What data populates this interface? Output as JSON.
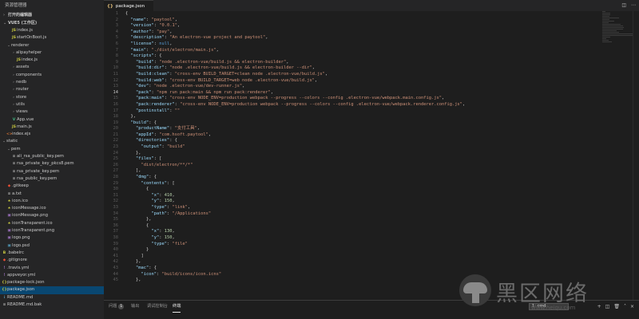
{
  "sidebar": {
    "title": "资源管理器",
    "open_editors": "打开的编辑器",
    "workspace": "VUE5 (工作区)",
    "items": [
      {
        "label": "index.js",
        "indent": 14,
        "icon": "JS",
        "color": "#cbcb41"
      },
      {
        "label": "startOnBoot.js",
        "indent": 14,
        "icon": "JS",
        "color": "#cbcb41"
      },
      {
        "label": "renderer",
        "indent": 8,
        "arrow": "⌄"
      },
      {
        "label": "alipayhelper",
        "indent": 14,
        "arrow": "›"
      },
      {
        "label": "index.js",
        "indent": 20,
        "icon": "JS",
        "color": "#cbcb41"
      },
      {
        "label": "assets",
        "indent": 14,
        "arrow": "›"
      },
      {
        "label": "components",
        "indent": 14,
        "arrow": "›"
      },
      {
        "label": "nedb",
        "indent": 14,
        "arrow": "›"
      },
      {
        "label": "router",
        "indent": 14,
        "arrow": "›"
      },
      {
        "label": "store",
        "indent": 14,
        "arrow": "›"
      },
      {
        "label": "utils",
        "indent": 14,
        "arrow": "›"
      },
      {
        "label": "views",
        "indent": 14,
        "arrow": "›"
      },
      {
        "label": "App.vue",
        "indent": 14,
        "icon": "V",
        "color": "#41b883"
      },
      {
        "label": "main.js",
        "indent": 14,
        "icon": "JS",
        "color": "#cbcb41"
      },
      {
        "label": "index.ejs",
        "indent": 8,
        "icon": "<>",
        "color": "#e37933"
      },
      {
        "label": "static",
        "indent": 2,
        "arrow": "⌄"
      },
      {
        "label": "pem",
        "indent": 8,
        "arrow": "⌄"
      },
      {
        "label": "ali_rsa_public_key.pem",
        "indent": 14,
        "icon": "≡",
        "color": "#aaaaaa"
      },
      {
        "label": "rsa_private_key_pkcs8.pem",
        "indent": 14,
        "icon": "≡",
        "color": "#aaaaaa"
      },
      {
        "label": "rsa_private_key.pem",
        "indent": 14,
        "icon": "≡",
        "color": "#aaaaaa"
      },
      {
        "label": "rsa_public_key.pem",
        "indent": 14,
        "icon": "≡",
        "color": "#aaaaaa"
      },
      {
        "label": ".gitkeep",
        "indent": 8,
        "icon": "◆",
        "color": "#f05033"
      },
      {
        "label": "a.txt",
        "indent": 8,
        "icon": "≡",
        "color": "#aaaaaa"
      },
      {
        "label": "icon.ico",
        "indent": 8,
        "icon": "★",
        "color": "#cbcb41"
      },
      {
        "label": "iconMessage.ico",
        "indent": 8,
        "icon": "★",
        "color": "#cbcb41"
      },
      {
        "label": "iconMessage.png",
        "indent": 8,
        "icon": "▣",
        "color": "#a074c4"
      },
      {
        "label": "iconTransparent.ico",
        "indent": 8,
        "icon": "★",
        "color": "#cbcb41"
      },
      {
        "label": "iconTransparent.png",
        "indent": 8,
        "icon": "▣",
        "color": "#a074c4"
      },
      {
        "label": "logo.png",
        "indent": 8,
        "icon": "▣",
        "color": "#a074c4"
      },
      {
        "label": "logo.psd",
        "indent": 8,
        "icon": "▣",
        "color": "#519aba"
      },
      {
        "label": ".babelrc",
        "indent": 2,
        "icon": "B",
        "color": "#cbcb41"
      },
      {
        "label": ".gitignore",
        "indent": 2,
        "icon": "◆",
        "color": "#f05033"
      },
      {
        "label": ".travis.yml",
        "indent": 2,
        "icon": "!",
        "color": "#a074c4"
      },
      {
        "label": "appveyor.yml",
        "indent": 2,
        "icon": "!",
        "color": "#a074c4"
      },
      {
        "label": "package-lock.json",
        "indent": 2,
        "icon": "{}",
        "color": "#cbcb41"
      },
      {
        "label": "package.json",
        "indent": 2,
        "icon": "{}",
        "color": "#cbcb41",
        "state": "active"
      },
      {
        "label": "README.md",
        "indent": 2,
        "icon": "i",
        "color": "#519aba"
      },
      {
        "label": "README.md.bak",
        "indent": 2,
        "icon": "≡",
        "color": "#aaaaaa"
      }
    ]
  },
  "tab": {
    "icon": "{}",
    "label": "package.json"
  },
  "editor": {
    "current_line": 14,
    "lines": [
      [
        [
          "p",
          "{"
        ]
      ],
      [
        [
          "p",
          "  "
        ],
        [
          "k",
          "\"name\""
        ],
        [
          "p",
          ": "
        ],
        [
          "s",
          "\"paytool\""
        ],
        [
          "p",
          ","
        ]
      ],
      [
        [
          "p",
          "  "
        ],
        [
          "k",
          "\"version\""
        ],
        [
          "p",
          ": "
        ],
        [
          "s",
          "\"0.0.1\""
        ],
        [
          "p",
          ","
        ]
      ],
      [
        [
          "p",
          "  "
        ],
        [
          "k",
          "\"author\""
        ],
        [
          "p",
          ": "
        ],
        [
          "s",
          "\"pay\""
        ],
        [
          "p",
          ","
        ]
      ],
      [
        [
          "p",
          "  "
        ],
        [
          "k",
          "\"description\""
        ],
        [
          "p",
          ": "
        ],
        [
          "s",
          "\"An electron-vue project and paytool\""
        ],
        [
          "p",
          ","
        ]
      ],
      [
        [
          "p",
          "  "
        ],
        [
          "k",
          "\"license\""
        ],
        [
          "p",
          ": "
        ],
        [
          "c",
          "null"
        ],
        [
          "p",
          ","
        ]
      ],
      [
        [
          "p",
          "  "
        ],
        [
          "k",
          "\"main\""
        ],
        [
          "p",
          ": "
        ],
        [
          "s",
          "\"./dist/electron/main.js\""
        ],
        [
          "p",
          ","
        ]
      ],
      [
        [
          "p",
          "  "
        ],
        [
          "k",
          "\"scripts\""
        ],
        [
          "p",
          ": {"
        ]
      ],
      [
        [
          "p",
          "    "
        ],
        [
          "k",
          "\"build\""
        ],
        [
          "p",
          ": "
        ],
        [
          "s",
          "\"node .electron-vue/build.js && electron-builder\""
        ],
        [
          "p",
          ","
        ]
      ],
      [
        [
          "p",
          "    "
        ],
        [
          "k",
          "\"build:dir\""
        ],
        [
          "p",
          ": "
        ],
        [
          "s",
          "\"node .electron-vue/build.js && electron-builder --dir\""
        ],
        [
          "p",
          ","
        ]
      ],
      [
        [
          "p",
          "    "
        ],
        [
          "k",
          "\"build:clean\""
        ],
        [
          "p",
          ": "
        ],
        [
          "s",
          "\"cross-env BUILD_TARGET=clean node .electron-vue/build.js\""
        ],
        [
          "p",
          ","
        ]
      ],
      [
        [
          "p",
          "    "
        ],
        [
          "k",
          "\"build:web\""
        ],
        [
          "p",
          ": "
        ],
        [
          "s",
          "\"cross-env BUILD_TARGET=web node .electron-vue/build.js\""
        ],
        [
          "p",
          ","
        ]
      ],
      [
        [
          "p",
          "    "
        ],
        [
          "k",
          "\"dev\""
        ],
        [
          "p",
          ": "
        ],
        [
          "s",
          "\"node .electron-vue/dev-runner.js\""
        ],
        [
          "p",
          ","
        ]
      ],
      [
        [
          "p",
          "    "
        ],
        [
          "k",
          "\"pack\""
        ],
        [
          "p",
          ": "
        ],
        [
          "s",
          "\"npm run pack:main && npm run pack:renderer\""
        ],
        [
          "p",
          ","
        ]
      ],
      [
        [
          "p",
          "    "
        ],
        [
          "k",
          "\"pack:main\""
        ],
        [
          "p",
          ": "
        ],
        [
          "s",
          "\"cross-env NODE_ENV=production webpack --progress --colors --config .electron-vue/webpack.main.config.js\""
        ],
        [
          "p",
          ","
        ]
      ],
      [
        [
          "p",
          "    "
        ],
        [
          "k",
          "\"pack:renderer\""
        ],
        [
          "p",
          ": "
        ],
        [
          "s",
          "\"cross-env NODE_ENV=production webpack --progress --colors --config .electron-vue/webpack.renderer.config.js\""
        ],
        [
          "p",
          ","
        ]
      ],
      [
        [
          "p",
          "    "
        ],
        [
          "k",
          "\"postinstall\""
        ],
        [
          "p",
          ": "
        ],
        [
          "s",
          "\"\""
        ]
      ],
      [
        [
          "p",
          "  },"
        ]
      ],
      [
        [
          "p",
          "  "
        ],
        [
          "k",
          "\"build\""
        ],
        [
          "p",
          ": {"
        ]
      ],
      [
        [
          "p",
          "    "
        ],
        [
          "k",
          "\"productName\""
        ],
        [
          "p",
          ": "
        ],
        [
          "s",
          "\"支付工具\""
        ],
        [
          "p",
          ","
        ]
      ],
      [
        [
          "p",
          "    "
        ],
        [
          "k",
          "\"appId\""
        ],
        [
          "p",
          ": "
        ],
        [
          "s",
          "\"com.hsoft.paytool\""
        ],
        [
          "p",
          ","
        ]
      ],
      [
        [
          "p",
          "    "
        ],
        [
          "k",
          "\"directories\""
        ],
        [
          "p",
          ": {"
        ]
      ],
      [
        [
          "p",
          "      "
        ],
        [
          "k",
          "\"output\""
        ],
        [
          "p",
          ": "
        ],
        [
          "s",
          "\"build\""
        ]
      ],
      [
        [
          "p",
          "    },"
        ]
      ],
      [
        [
          "p",
          "    "
        ],
        [
          "k",
          "\"files\""
        ],
        [
          "p",
          ": ["
        ]
      ],
      [
        [
          "p",
          "      "
        ],
        [
          "s",
          "\"dist/electron/**/*\""
        ]
      ],
      [
        [
          "p",
          "    ],"
        ]
      ],
      [
        [
          "p",
          "    "
        ],
        [
          "k",
          "\"dmg\""
        ],
        [
          "p",
          ": {"
        ]
      ],
      [
        [
          "p",
          "      "
        ],
        [
          "k",
          "\"contents\""
        ],
        [
          "p",
          ": ["
        ]
      ],
      [
        [
          "p",
          "        {"
        ]
      ],
      [
        [
          "p",
          "          "
        ],
        [
          "k",
          "\"x\""
        ],
        [
          "p",
          ": "
        ],
        [
          "n",
          "410"
        ],
        [
          "p",
          ","
        ]
      ],
      [
        [
          "p",
          "          "
        ],
        [
          "k",
          "\"y\""
        ],
        [
          "p",
          ": "
        ],
        [
          "n",
          "150"
        ],
        [
          "p",
          ","
        ]
      ],
      [
        [
          "p",
          "          "
        ],
        [
          "k",
          "\"type\""
        ],
        [
          "p",
          ": "
        ],
        [
          "s",
          "\"link\""
        ],
        [
          "p",
          ","
        ]
      ],
      [
        [
          "p",
          "          "
        ],
        [
          "k",
          "\"path\""
        ],
        [
          "p",
          ": "
        ],
        [
          "s",
          "\"/Applications\""
        ]
      ],
      [
        [
          "p",
          "        },"
        ]
      ],
      [
        [
          "p",
          "        {"
        ]
      ],
      [
        [
          "p",
          "          "
        ],
        [
          "k",
          "\"x\""
        ],
        [
          "p",
          ": "
        ],
        [
          "n",
          "130"
        ],
        [
          "p",
          ","
        ]
      ],
      [
        [
          "p",
          "          "
        ],
        [
          "k",
          "\"y\""
        ],
        [
          "p",
          ": "
        ],
        [
          "n",
          "150"
        ],
        [
          "p",
          ","
        ]
      ],
      [
        [
          "p",
          "          "
        ],
        [
          "k",
          "\"type\""
        ],
        [
          "p",
          ": "
        ],
        [
          "s",
          "\"file\""
        ]
      ],
      [
        [
          "p",
          "        }"
        ]
      ],
      [
        [
          "p",
          "      ]"
        ]
      ],
      [
        [
          "p",
          "    },"
        ]
      ],
      [
        [
          "p",
          "    "
        ],
        [
          "k",
          "\"mac\""
        ],
        [
          "p",
          ": {"
        ]
      ],
      [
        [
          "p",
          "      "
        ],
        [
          "k",
          "\"icon\""
        ],
        [
          "p",
          ": "
        ],
        [
          "s",
          "\"build/icons/icon.icns\""
        ]
      ],
      [
        [
          "p",
          "    },"
        ]
      ]
    ]
  },
  "panel": {
    "tabs": [
      {
        "label": "问题",
        "badge": "1"
      },
      {
        "label": "输出"
      },
      {
        "label": "调试控制台"
      },
      {
        "label": "终端",
        "active": true
      }
    ],
    "terminal_select": "1: cmd",
    "icons": [
      "add-icon",
      "split-icon",
      "trash-icon",
      "chevron-up-icon",
      "close-icon"
    ]
  },
  "watermark": {
    "text": "黑区网络",
    "sub": "www.heiqu.com"
  },
  "colors": {
    "accent": "#094771",
    "key": "#9cdcfe",
    "string": "#ce9178",
    "number": "#b5cea8",
    "keyword": "#569cd6"
  }
}
